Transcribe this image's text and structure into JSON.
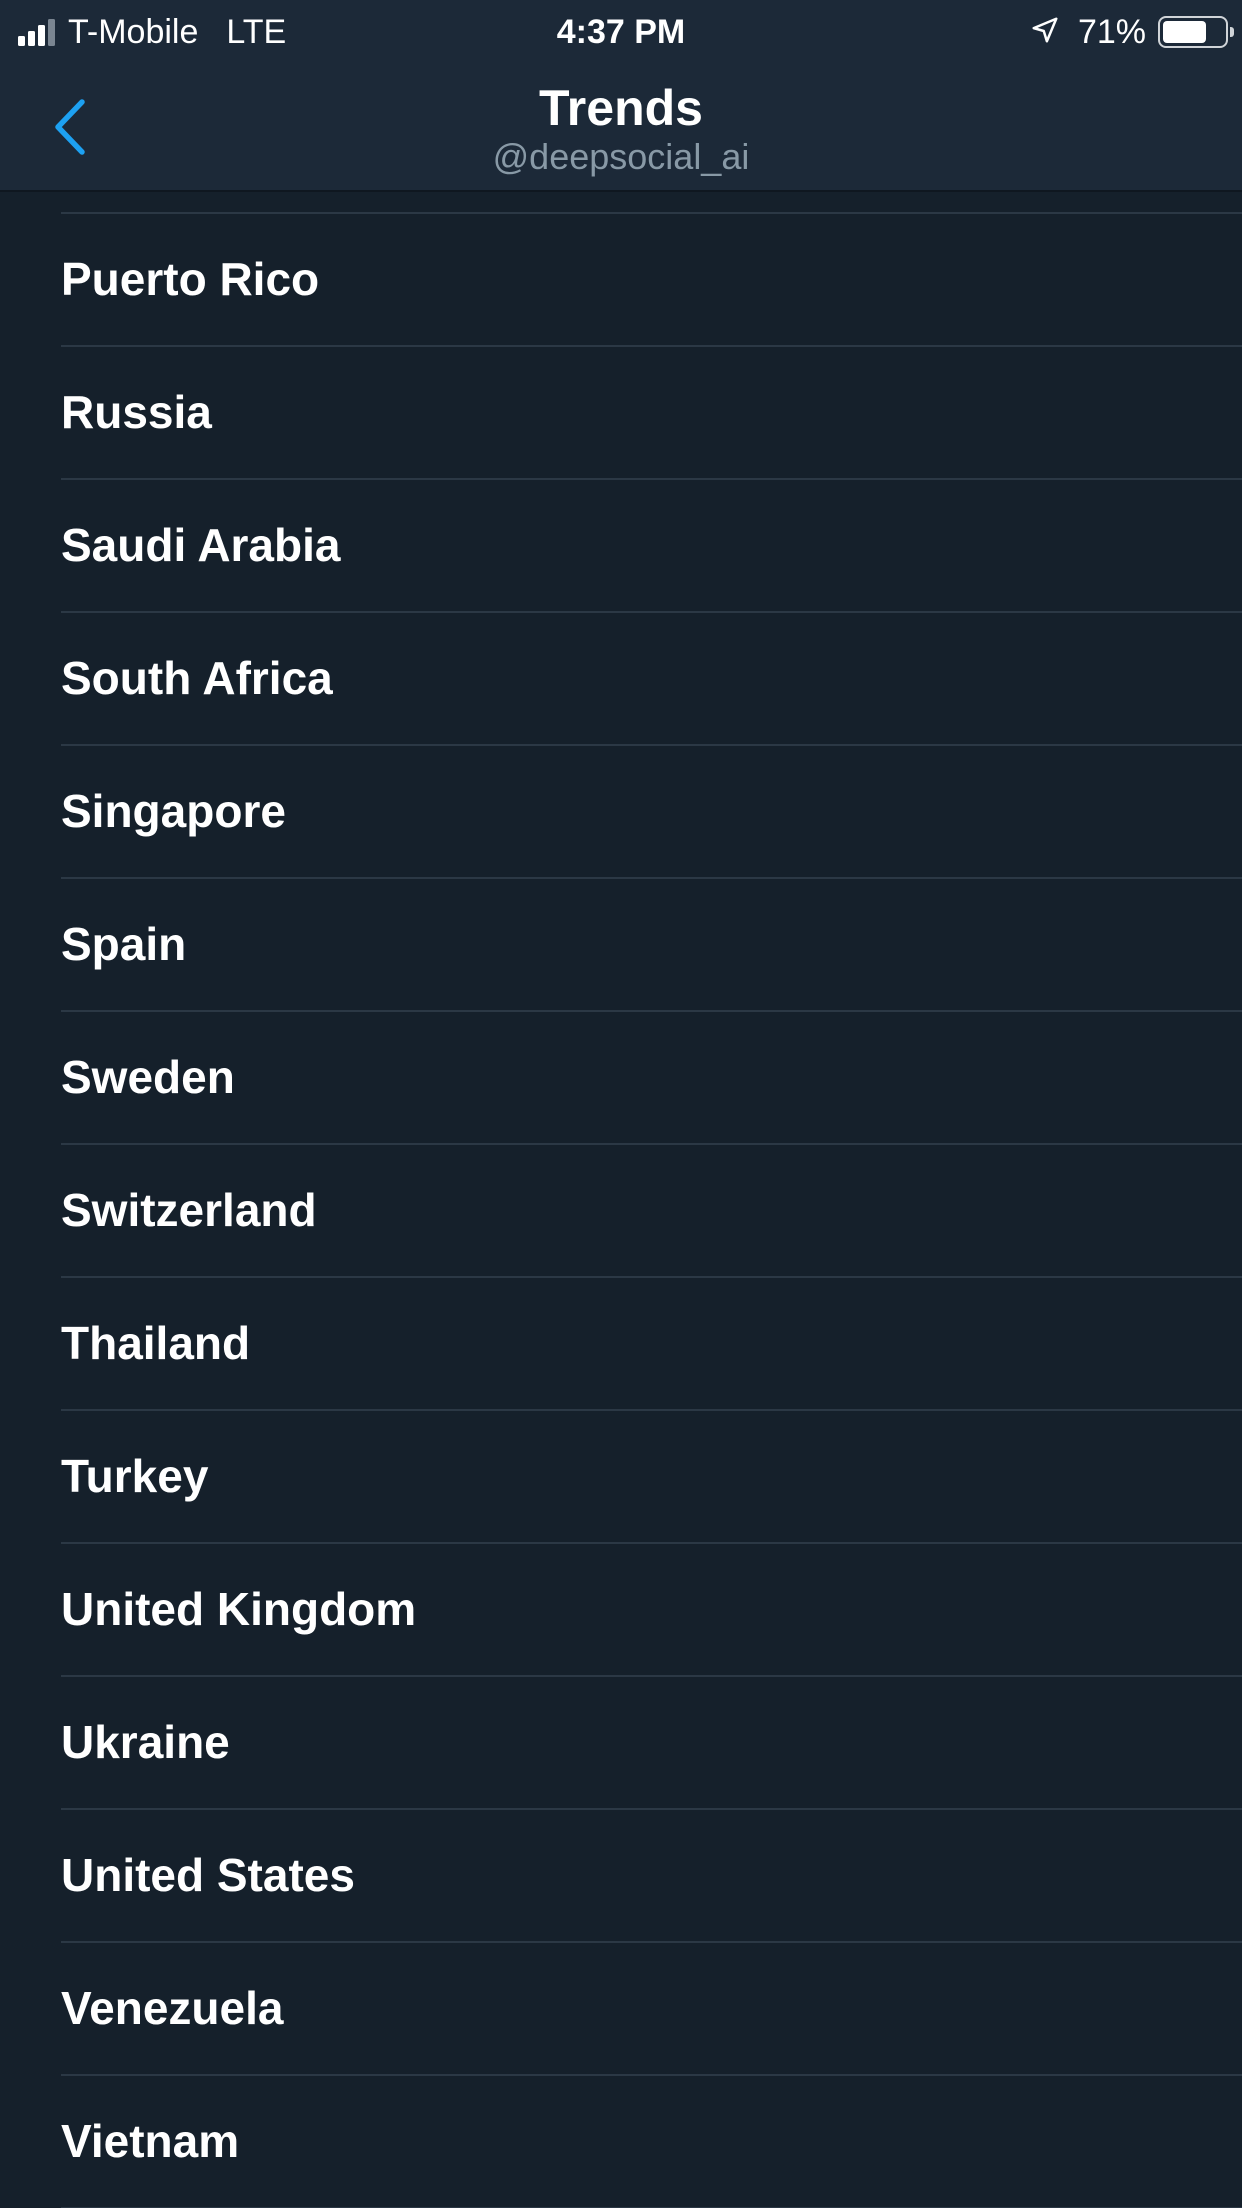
{
  "status_bar": {
    "carrier": "T-Mobile",
    "network": "LTE",
    "time": "4:37 PM",
    "battery_percent_text": "71%",
    "battery_level": 0.71,
    "signal_bars_filled": 3,
    "signal_bars_total": 4,
    "icons": [
      "signal-icon",
      "location-arrow-icon",
      "battery-icon"
    ]
  },
  "nav": {
    "title": "Trends",
    "subtitle": "@deepsocial_ai",
    "back_icon": "chevron-left-icon"
  },
  "colors": {
    "accent": "#1da1f2",
    "nav_background": "#1c2938",
    "list_background": "#15202b",
    "separator": "#2b3845",
    "subtitle": "#8899a6"
  },
  "locations": [
    {
      "label": "Puerto Rico"
    },
    {
      "label": "Russia"
    },
    {
      "label": "Saudi Arabia"
    },
    {
      "label": "South Africa"
    },
    {
      "label": "Singapore"
    },
    {
      "label": "Spain"
    },
    {
      "label": "Sweden"
    },
    {
      "label": "Switzerland"
    },
    {
      "label": "Thailand"
    },
    {
      "label": "Turkey"
    },
    {
      "label": "United Kingdom"
    },
    {
      "label": "Ukraine"
    },
    {
      "label": "United States"
    },
    {
      "label": "Venezuela"
    },
    {
      "label": "Vietnam"
    }
  ]
}
